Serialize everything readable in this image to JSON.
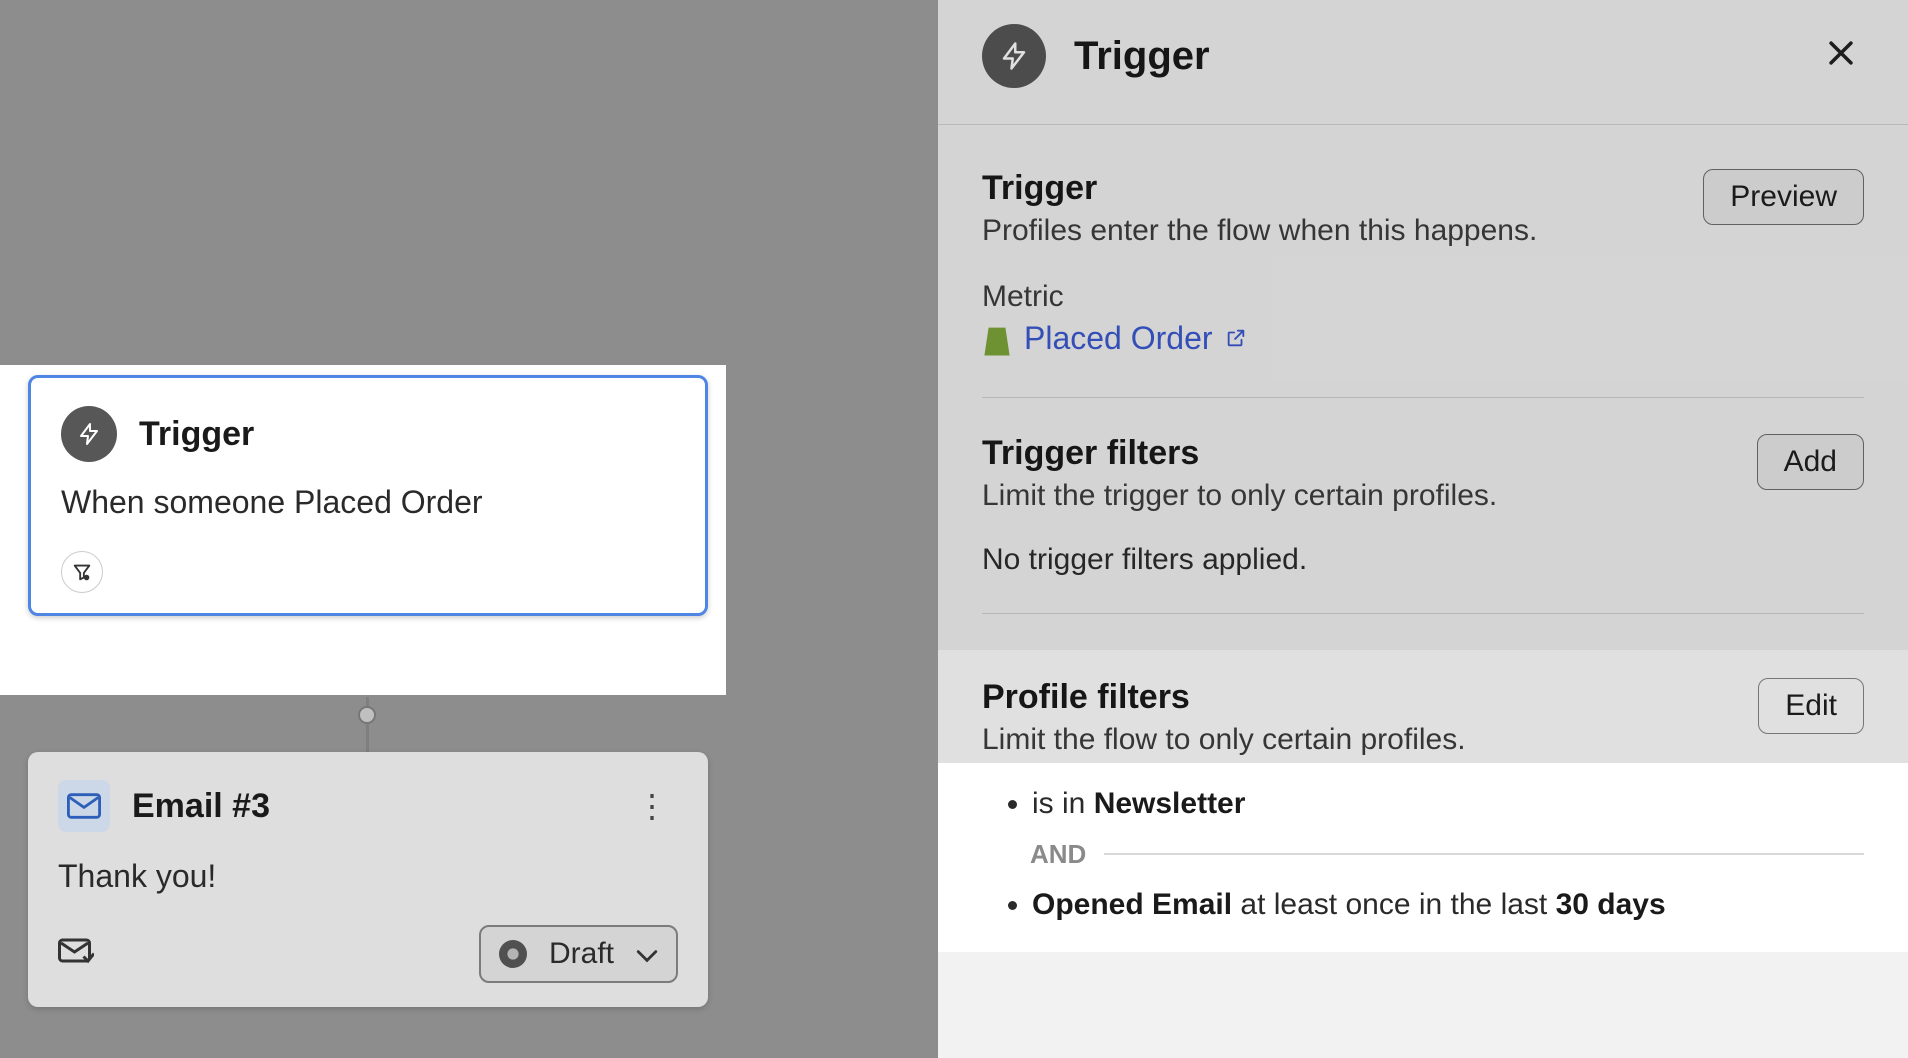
{
  "panel": {
    "title": "Trigger",
    "trigger_section": {
      "heading": "Trigger",
      "desc": "Profiles enter the flow when this happens.",
      "preview_btn": "Preview",
      "metric_label": "Metric",
      "metric_value": "Placed Order"
    },
    "trigger_filters": {
      "heading": "Trigger filters",
      "desc": "Limit the trigger to only certain profiles.",
      "add_btn": "Add",
      "empty": "No trigger filters applied."
    },
    "profile_filters": {
      "heading": "Profile filters",
      "desc": "Limit the flow to only certain profiles.",
      "edit_btn": "Edit",
      "items": [
        {
          "prefix": "is in ",
          "bold": "Newsletter",
          "suffix": ""
        },
        {
          "prefix": "",
          "bold": "Opened Email",
          "mid": " at least once in the last ",
          "bold2": "30 days",
          "suffix": ""
        }
      ],
      "connector": "AND"
    }
  },
  "canvas": {
    "trigger_node": {
      "title": "Trigger",
      "body": "When someone Placed Order"
    },
    "email_node": {
      "title": "Email #3",
      "body": "Thank you!",
      "status": "Draft"
    }
  }
}
